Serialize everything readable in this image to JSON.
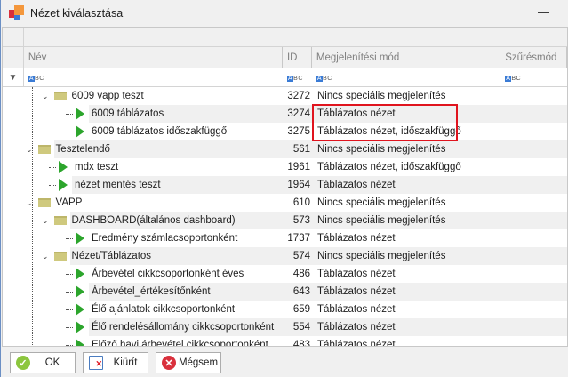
{
  "window": {
    "title": "Nézet kiválasztása",
    "minimize": "—"
  },
  "columns": [
    "Név",
    "ID",
    "Megjelenítési mód",
    "Szűrésmód"
  ],
  "rows": [
    {
      "name": "6009 vapp teszt",
      "id": "3272",
      "mode": "Nincs speciális megjelenítés",
      "type": "folder",
      "level": 2
    },
    {
      "name": "6009 táblázatos",
      "id": "3274",
      "mode": "Táblázatos nézet",
      "type": "leaf",
      "level": 3
    },
    {
      "name": "6009 táblázatos időszakfüggő",
      "id": "3275",
      "mode": "Táblázatos nézet, időszakfüggő",
      "type": "leaf",
      "level": 3
    },
    {
      "name": "Tesztelendő",
      "id": "561",
      "mode": "Nincs speciális megjelenítés",
      "type": "folder",
      "level": 1
    },
    {
      "name": "mdx teszt",
      "id": "1961",
      "mode": "Táblázatos nézet, időszakfüggő",
      "type": "leaf",
      "level": 2
    },
    {
      "name": "nézet mentés teszt",
      "id": "1964",
      "mode": "Táblázatos nézet",
      "type": "leaf",
      "level": 2
    },
    {
      "name": "VAPP",
      "id": "610",
      "mode": "Nincs speciális megjelenítés",
      "type": "folder",
      "level": 1
    },
    {
      "name": "DASHBOARD(általános dashboard)",
      "id": "573",
      "mode": "Nincs speciális megjelenítés",
      "type": "folder",
      "level": 2
    },
    {
      "name": "Eredmény számlacsoportonként",
      "id": "1737",
      "mode": "Táblázatos nézet",
      "type": "leaf",
      "level": 3
    },
    {
      "name": "Nézet/Táblázatos",
      "id": "574",
      "mode": "Nincs speciális megjelenítés",
      "type": "folder",
      "level": 2
    },
    {
      "name": "Árbevétel cikkcsoportonként éves",
      "id": "486",
      "mode": "Táblázatos nézet",
      "type": "leaf",
      "level": 3
    },
    {
      "name": "Árbevétel_értékesítőnként",
      "id": "643",
      "mode": "Táblázatos nézet",
      "type": "leaf",
      "level": 3
    },
    {
      "name": "Élő ajánlatok cikkcsoportonként",
      "id": "659",
      "mode": "Táblázatos nézet",
      "type": "leaf",
      "level": 3
    },
    {
      "name": "Élő rendelésállomány cikkcsoportonként",
      "id": "554",
      "mode": "Táblázatos nézet",
      "type": "leaf",
      "level": 3
    },
    {
      "name": "Előző havi  árbevétel cikkcsoportonként",
      "id": "483",
      "mode": "Táblázatos nézet",
      "type": "leaf",
      "level": 3
    }
  ],
  "buttons": {
    "ok": "OK",
    "clear": "Kiürít",
    "cancel": "Mégsem"
  },
  "filter_icon_text": "ABC",
  "colors": {
    "highlight": "#e0141e",
    "leaf": "#2ca52c",
    "folder": "#cfc97e"
  }
}
